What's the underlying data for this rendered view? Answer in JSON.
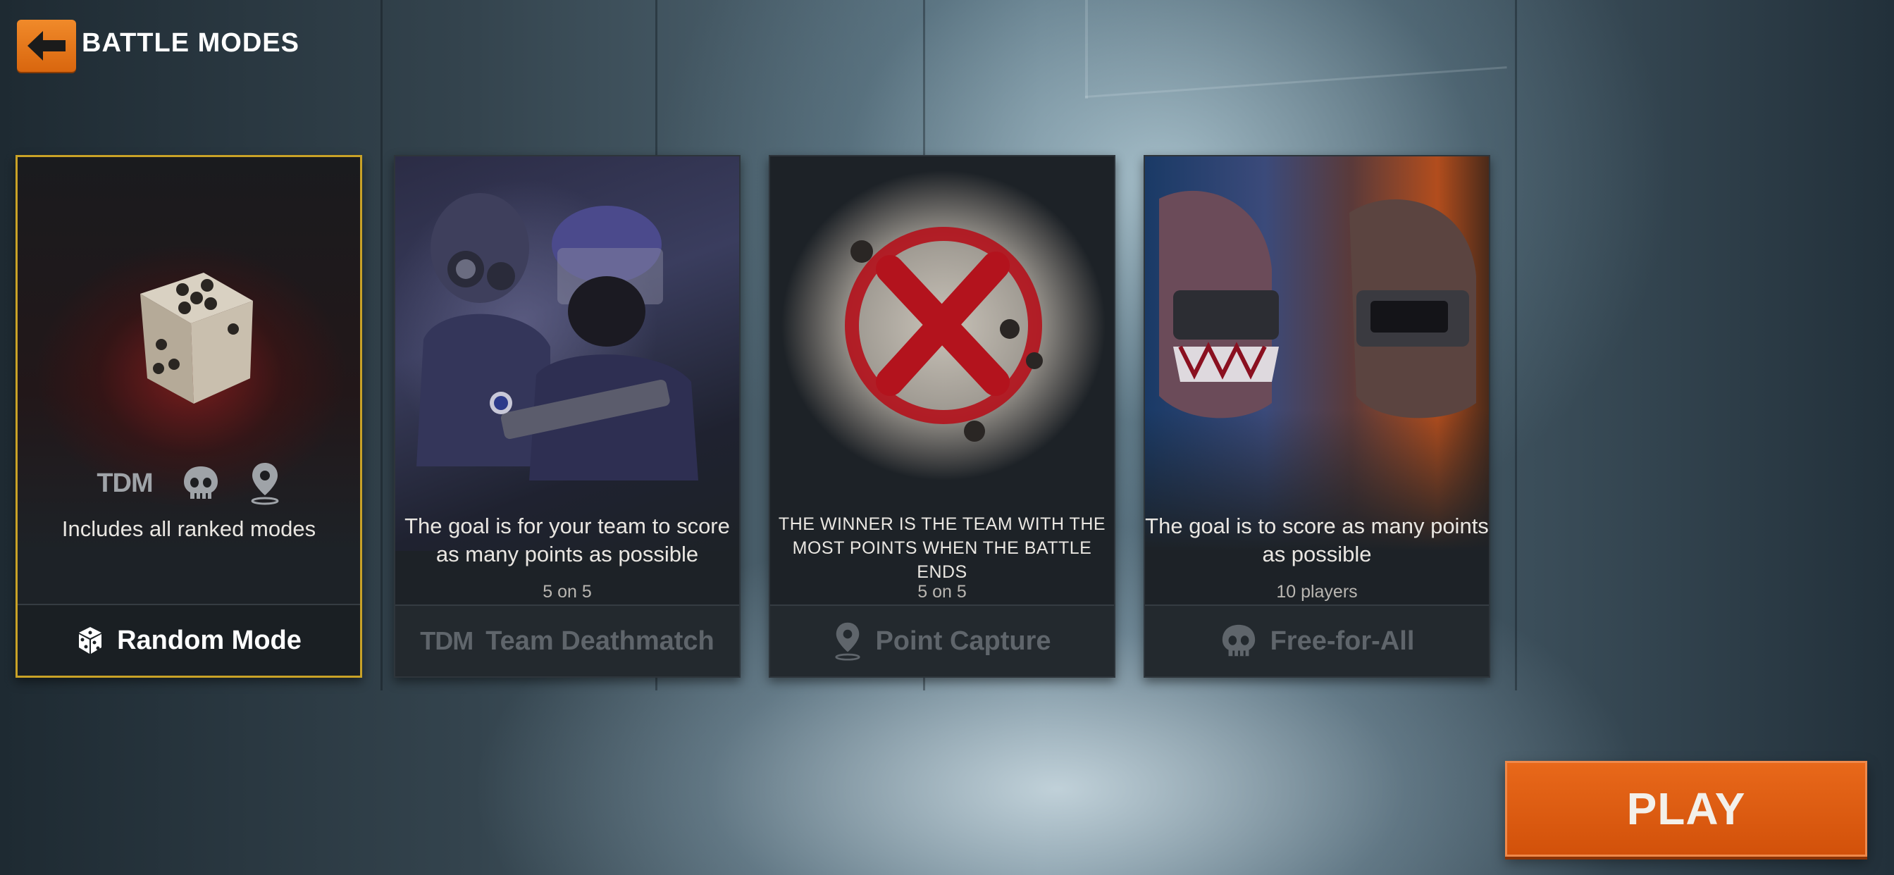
{
  "header": {
    "title": "BATTLE MODES"
  },
  "cards": [
    {
      "mode_icons": [
        "TDM",
        "skull-icon",
        "map-pin-icon"
      ],
      "description": "Includes all ranked modes",
      "footer_label": "Random Mode",
      "footer_icon": "dice-icon",
      "selected": true
    },
    {
      "description": "The goal is for your team to score as many points as possible",
      "count": "5 on 5",
      "footer_label": "Team Deathmatch",
      "footer_icon": "TDM",
      "selected": false
    },
    {
      "description": "THE WINNER IS THE TEAM WITH THE MOST POINTS WHEN THE BATTLE ENDS",
      "count": "5 on 5",
      "footer_label": "Point Capture",
      "footer_icon": "map-pin-icon",
      "selected": false
    },
    {
      "description": "The goal is to score as many points as possible",
      "count": "10 players",
      "footer_label": "Free-for-All",
      "footer_icon": "skull-icon",
      "selected": false
    }
  ],
  "play": {
    "label": "PLAY"
  },
  "colors": {
    "accent": "#e0600f",
    "selected_border": "#c9a227"
  }
}
